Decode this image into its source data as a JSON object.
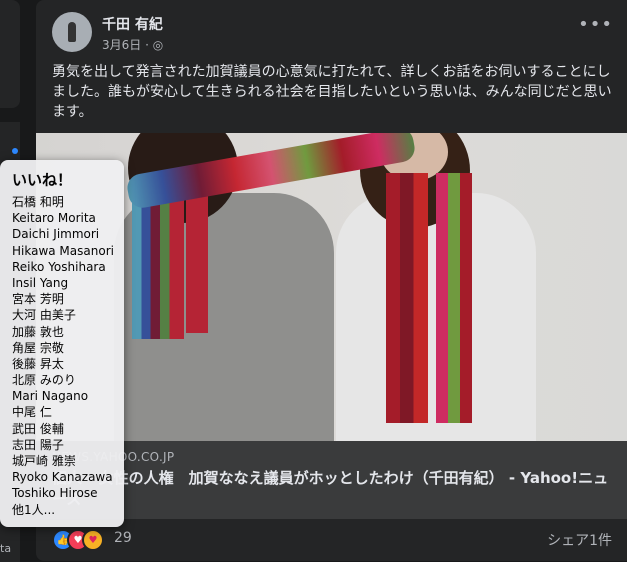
{
  "post": {
    "author": "千田 有紀",
    "date": "3月6日",
    "privacy_icon": "globe-icon",
    "more_icon": "more-horizontal-icon",
    "more_label": "•••",
    "privacy_glyph": "◎",
    "separator": "·",
    "text": "勇気を出して発言された加賀議員の心意気に打たれて、詳しくお話をお伺いすることにしました。誰もが安心して生きられる社会を目指したいという思いは、みんな同じだと思います。"
  },
  "link": {
    "domain": "NEWS.YAHOO.CO.JP",
    "title": "個人 - 女性の人権　加賀ななえ議員がホッとしたわけ（千田有紀） - Yahoo!ニュース"
  },
  "reactions": {
    "types": [
      "like",
      "love",
      "care"
    ],
    "like_glyph": "👍",
    "love_glyph": "♥",
    "care_glyph": "♥",
    "count": "29",
    "colors": {
      "like": "#2d88ff",
      "love": "#f33e58",
      "care": "#f7b125"
    }
  },
  "shares": {
    "label": "シェア1件"
  },
  "tooltip": {
    "title": "いいね！",
    "names": [
      "石橋 和明",
      "Keitaro Morita",
      "Daichi Jimmori",
      "Hikawa Masanori",
      "Reiko Yoshihara",
      "Insil Yang",
      "宮本 芳明",
      "大河 由美子",
      "加藤 敦也",
      "角屋 宗敬",
      "後藤 昇太",
      "北原 みのり",
      "Mari Nagano",
      "中尾 仁",
      "武田 俊輔",
      "志田 陽子",
      "城戸崎 雅崇",
      "Ryoko Kanazawa",
      "Toshiko Hirose",
      "他1人..."
    ]
  },
  "left_fragment": "ta"
}
